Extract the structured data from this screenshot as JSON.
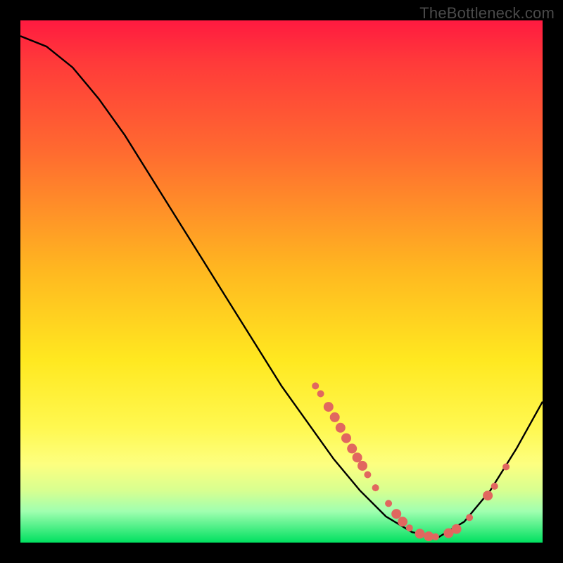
{
  "watermark": "TheBottleneck.com",
  "chart_data": {
    "type": "line",
    "title": "",
    "xlabel": "",
    "ylabel": "",
    "xlim": [
      0,
      100
    ],
    "ylim": [
      0,
      100
    ],
    "curve": [
      {
        "x": 0,
        "y": 97
      },
      {
        "x": 5,
        "y": 95
      },
      {
        "x": 10,
        "y": 91
      },
      {
        "x": 15,
        "y": 85
      },
      {
        "x": 20,
        "y": 78
      },
      {
        "x": 25,
        "y": 70
      },
      {
        "x": 30,
        "y": 62
      },
      {
        "x": 35,
        "y": 54
      },
      {
        "x": 40,
        "y": 46
      },
      {
        "x": 45,
        "y": 38
      },
      {
        "x": 50,
        "y": 30
      },
      {
        "x": 55,
        "y": 23
      },
      {
        "x": 60,
        "y": 16
      },
      {
        "x": 65,
        "y": 10
      },
      {
        "x": 70,
        "y": 5
      },
      {
        "x": 75,
        "y": 2
      },
      {
        "x": 80,
        "y": 1
      },
      {
        "x": 85,
        "y": 4
      },
      {
        "x": 90,
        "y": 10
      },
      {
        "x": 95,
        "y": 18
      },
      {
        "x": 100,
        "y": 27
      }
    ],
    "markers": [
      {
        "x": 56.5,
        "y": 30,
        "r": 5
      },
      {
        "x": 57.5,
        "y": 28.5,
        "r": 5
      },
      {
        "x": 59,
        "y": 26,
        "r": 7
      },
      {
        "x": 60.2,
        "y": 24,
        "r": 7
      },
      {
        "x": 61.3,
        "y": 22,
        "r": 7
      },
      {
        "x": 62.4,
        "y": 20,
        "r": 7
      },
      {
        "x": 63.5,
        "y": 18,
        "r": 7
      },
      {
        "x": 64.5,
        "y": 16.3,
        "r": 7
      },
      {
        "x": 65.5,
        "y": 14.7,
        "r": 7
      },
      {
        "x": 66.5,
        "y": 13,
        "r": 5
      },
      {
        "x": 68,
        "y": 10.5,
        "r": 5
      },
      {
        "x": 70.5,
        "y": 7.5,
        "r": 5
      },
      {
        "x": 72,
        "y": 5.5,
        "r": 7
      },
      {
        "x": 73.2,
        "y": 4,
        "r": 7
      },
      {
        "x": 74.5,
        "y": 2.8,
        "r": 5
      },
      {
        "x": 76.5,
        "y": 1.7,
        "r": 7
      },
      {
        "x": 78.2,
        "y": 1.2,
        "r": 7
      },
      {
        "x": 79.5,
        "y": 1.1,
        "r": 5
      },
      {
        "x": 82,
        "y": 1.8,
        "r": 7
      },
      {
        "x": 83.5,
        "y": 2.6,
        "r": 7
      },
      {
        "x": 86,
        "y": 4.8,
        "r": 5
      },
      {
        "x": 89.5,
        "y": 9,
        "r": 7
      },
      {
        "x": 90.8,
        "y": 10.8,
        "r": 5
      },
      {
        "x": 93,
        "y": 14.5,
        "r": 5
      }
    ],
    "marker_color": "#e1675f",
    "curve_color": "#000000"
  }
}
